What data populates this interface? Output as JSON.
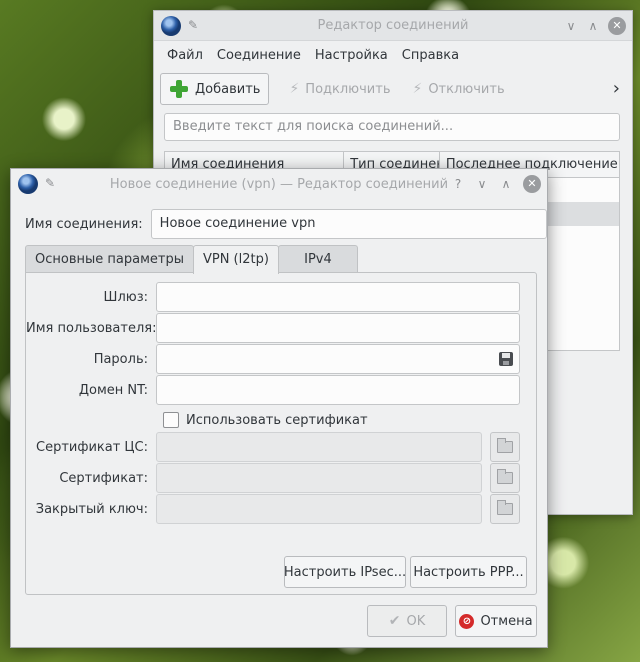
{
  "background_window": {
    "title": "Редактор соединений",
    "menu": [
      "Файл",
      "Соединение",
      "Настройка",
      "Справка"
    ],
    "toolbar": {
      "add": "Добавить",
      "connect": "Подключить",
      "disconnect": "Отключить",
      "more": "›"
    },
    "search": {
      "placeholder": "Введите текст для поиска соединений..."
    },
    "columns": [
      "Имя соединения",
      "Тип соединен",
      "Последнее подключение"
    ]
  },
  "dialog": {
    "title": "Новое соединение (vpn) — Редактор соединений",
    "help": "?",
    "connection_name": {
      "label": "Имя соединения:",
      "value": "Новое соединение vpn"
    },
    "tabs": [
      {
        "label": "Основные параметры",
        "active": false
      },
      {
        "label": "VPN (l2tp)",
        "active": true
      },
      {
        "label": "IPv4",
        "active": false
      }
    ],
    "vpn": {
      "gateway": {
        "label": "Шлюз:",
        "value": ""
      },
      "username": {
        "label": "Имя пользователя:",
        "value": ""
      },
      "password": {
        "label": "Пароль:",
        "value": ""
      },
      "nt_domain": {
        "label": "Домен NT:",
        "value": ""
      },
      "use_certificate": {
        "label": "Использовать сертификат",
        "checked": false
      },
      "ca_cert": {
        "label": "Сертификат ЦС:",
        "value": ""
      },
      "cert": {
        "label": "Сертификат:",
        "value": ""
      },
      "private_key": {
        "label": "Закрытый ключ:",
        "value": ""
      },
      "ipsec_button": "Настроить IPsec...",
      "ppp_button": "Настроить PPP..."
    },
    "buttons": {
      "ok": "OK",
      "cancel": "Отмена"
    }
  }
}
